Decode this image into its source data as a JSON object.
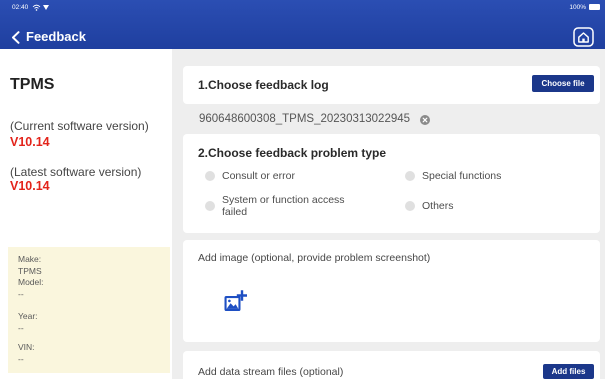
{
  "status_bar": {
    "time": "02:40",
    "battery": "100%"
  },
  "header": {
    "title": "Feedback"
  },
  "sidebar": {
    "title": "TPMS",
    "current_label": "(Current software version)",
    "current_version": "V10.14",
    "latest_label": "(Latest software version)",
    "latest_version": "V10.14",
    "info": [
      {
        "label": "Make:",
        "value": "TPMS"
      },
      {
        "label": "Model:",
        "value": "--"
      },
      {
        "label": "Year:",
        "value": "--"
      },
      {
        "label": "VIN:",
        "value": "--"
      }
    ]
  },
  "log_section": {
    "title": "1.Choose feedback log",
    "button": "Choose file",
    "file_name": "960648600308_TPMS_20230313022945"
  },
  "problem_section": {
    "title": "2.Choose feedback problem type",
    "options": [
      "Consult or error",
      "Special functions",
      "System or function access failed",
      "Others"
    ]
  },
  "image_section": {
    "label": "Add image (optional, provide problem screenshot)"
  },
  "files_section": {
    "label": "Add data stream files (optional)",
    "button": "Add files"
  },
  "icons": {
    "back": "chevron-left-icon",
    "home": "home-icon",
    "remove_file": "close-circle-icon",
    "add_image": "image-plus-icon",
    "wifi": "wifi-icon",
    "battery": "battery-icon"
  },
  "colors": {
    "header_top": "#2b4eb3",
    "header_bottom": "#1f3f9f",
    "button": "#1b378a",
    "version_red": "#e3241b",
    "accent_icon": "#1e4fc3",
    "info_box_bg": "#faf6dd"
  }
}
